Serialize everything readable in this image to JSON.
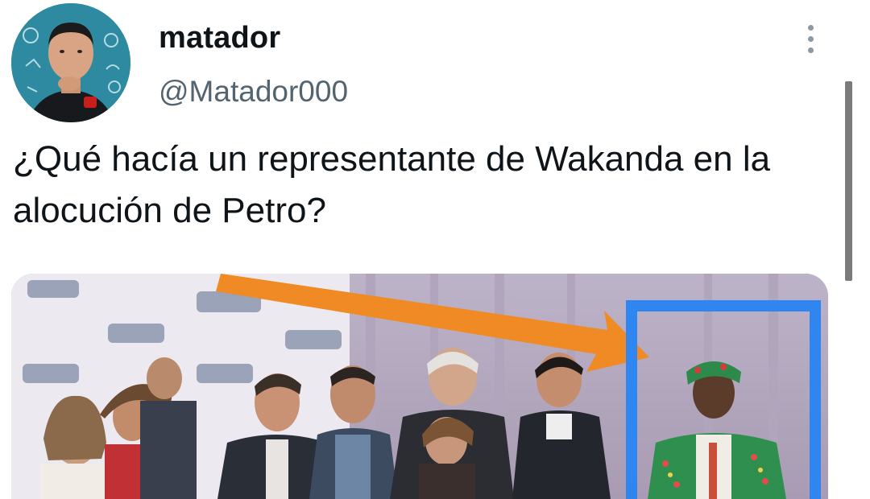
{
  "author": {
    "display_name": "matador",
    "handle": "@Matador000",
    "avatar_icon": "profile-avatar"
  },
  "tweet": {
    "text": "¿Qué hacía un representante de Wakanda en la alocución de Petro?"
  },
  "media": {
    "type": "photo",
    "annotations": {
      "arrow_color": "#f08a24",
      "box_color": "#2f86f0"
    }
  },
  "icons": {
    "more": "more-options-icon"
  },
  "colors": {
    "text_primary": "#0f1419",
    "text_secondary": "#536471"
  }
}
